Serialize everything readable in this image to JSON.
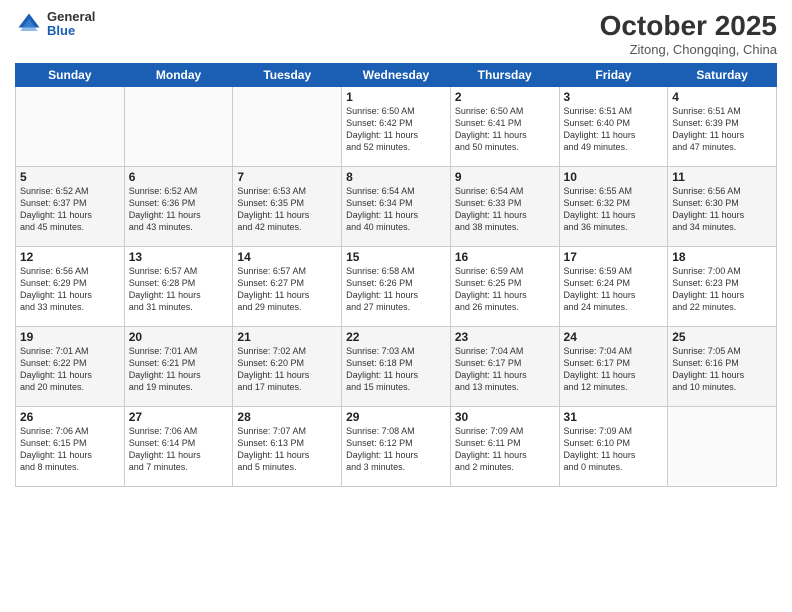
{
  "header": {
    "logo_general": "General",
    "logo_blue": "Blue",
    "month_title": "October 2025",
    "location": "Zitong, Chongqing, China"
  },
  "days_of_week": [
    "Sunday",
    "Monday",
    "Tuesday",
    "Wednesday",
    "Thursday",
    "Friday",
    "Saturday"
  ],
  "weeks": [
    [
      {
        "day": "",
        "info": ""
      },
      {
        "day": "",
        "info": ""
      },
      {
        "day": "",
        "info": ""
      },
      {
        "day": "1",
        "info": "Sunrise: 6:50 AM\nSunset: 6:42 PM\nDaylight: 11 hours\nand 52 minutes."
      },
      {
        "day": "2",
        "info": "Sunrise: 6:50 AM\nSunset: 6:41 PM\nDaylight: 11 hours\nand 50 minutes."
      },
      {
        "day": "3",
        "info": "Sunrise: 6:51 AM\nSunset: 6:40 PM\nDaylight: 11 hours\nand 49 minutes."
      },
      {
        "day": "4",
        "info": "Sunrise: 6:51 AM\nSunset: 6:39 PM\nDaylight: 11 hours\nand 47 minutes."
      }
    ],
    [
      {
        "day": "5",
        "info": "Sunrise: 6:52 AM\nSunset: 6:37 PM\nDaylight: 11 hours\nand 45 minutes."
      },
      {
        "day": "6",
        "info": "Sunrise: 6:52 AM\nSunset: 6:36 PM\nDaylight: 11 hours\nand 43 minutes."
      },
      {
        "day": "7",
        "info": "Sunrise: 6:53 AM\nSunset: 6:35 PM\nDaylight: 11 hours\nand 42 minutes."
      },
      {
        "day": "8",
        "info": "Sunrise: 6:54 AM\nSunset: 6:34 PM\nDaylight: 11 hours\nand 40 minutes."
      },
      {
        "day": "9",
        "info": "Sunrise: 6:54 AM\nSunset: 6:33 PM\nDaylight: 11 hours\nand 38 minutes."
      },
      {
        "day": "10",
        "info": "Sunrise: 6:55 AM\nSunset: 6:32 PM\nDaylight: 11 hours\nand 36 minutes."
      },
      {
        "day": "11",
        "info": "Sunrise: 6:56 AM\nSunset: 6:30 PM\nDaylight: 11 hours\nand 34 minutes."
      }
    ],
    [
      {
        "day": "12",
        "info": "Sunrise: 6:56 AM\nSunset: 6:29 PM\nDaylight: 11 hours\nand 33 minutes."
      },
      {
        "day": "13",
        "info": "Sunrise: 6:57 AM\nSunset: 6:28 PM\nDaylight: 11 hours\nand 31 minutes."
      },
      {
        "day": "14",
        "info": "Sunrise: 6:57 AM\nSunset: 6:27 PM\nDaylight: 11 hours\nand 29 minutes."
      },
      {
        "day": "15",
        "info": "Sunrise: 6:58 AM\nSunset: 6:26 PM\nDaylight: 11 hours\nand 27 minutes."
      },
      {
        "day": "16",
        "info": "Sunrise: 6:59 AM\nSunset: 6:25 PM\nDaylight: 11 hours\nand 26 minutes."
      },
      {
        "day": "17",
        "info": "Sunrise: 6:59 AM\nSunset: 6:24 PM\nDaylight: 11 hours\nand 24 minutes."
      },
      {
        "day": "18",
        "info": "Sunrise: 7:00 AM\nSunset: 6:23 PM\nDaylight: 11 hours\nand 22 minutes."
      }
    ],
    [
      {
        "day": "19",
        "info": "Sunrise: 7:01 AM\nSunset: 6:22 PM\nDaylight: 11 hours\nand 20 minutes."
      },
      {
        "day": "20",
        "info": "Sunrise: 7:01 AM\nSunset: 6:21 PM\nDaylight: 11 hours\nand 19 minutes."
      },
      {
        "day": "21",
        "info": "Sunrise: 7:02 AM\nSunset: 6:20 PM\nDaylight: 11 hours\nand 17 minutes."
      },
      {
        "day": "22",
        "info": "Sunrise: 7:03 AM\nSunset: 6:18 PM\nDaylight: 11 hours\nand 15 minutes."
      },
      {
        "day": "23",
        "info": "Sunrise: 7:04 AM\nSunset: 6:17 PM\nDaylight: 11 hours\nand 13 minutes."
      },
      {
        "day": "24",
        "info": "Sunrise: 7:04 AM\nSunset: 6:17 PM\nDaylight: 11 hours\nand 12 minutes."
      },
      {
        "day": "25",
        "info": "Sunrise: 7:05 AM\nSunset: 6:16 PM\nDaylight: 11 hours\nand 10 minutes."
      }
    ],
    [
      {
        "day": "26",
        "info": "Sunrise: 7:06 AM\nSunset: 6:15 PM\nDaylight: 11 hours\nand 8 minutes."
      },
      {
        "day": "27",
        "info": "Sunrise: 7:06 AM\nSunset: 6:14 PM\nDaylight: 11 hours\nand 7 minutes."
      },
      {
        "day": "28",
        "info": "Sunrise: 7:07 AM\nSunset: 6:13 PM\nDaylight: 11 hours\nand 5 minutes."
      },
      {
        "day": "29",
        "info": "Sunrise: 7:08 AM\nSunset: 6:12 PM\nDaylight: 11 hours\nand 3 minutes."
      },
      {
        "day": "30",
        "info": "Sunrise: 7:09 AM\nSunset: 6:11 PM\nDaylight: 11 hours\nand 2 minutes."
      },
      {
        "day": "31",
        "info": "Sunrise: 7:09 AM\nSunset: 6:10 PM\nDaylight: 11 hours\nand 0 minutes."
      },
      {
        "day": "",
        "info": ""
      }
    ]
  ]
}
